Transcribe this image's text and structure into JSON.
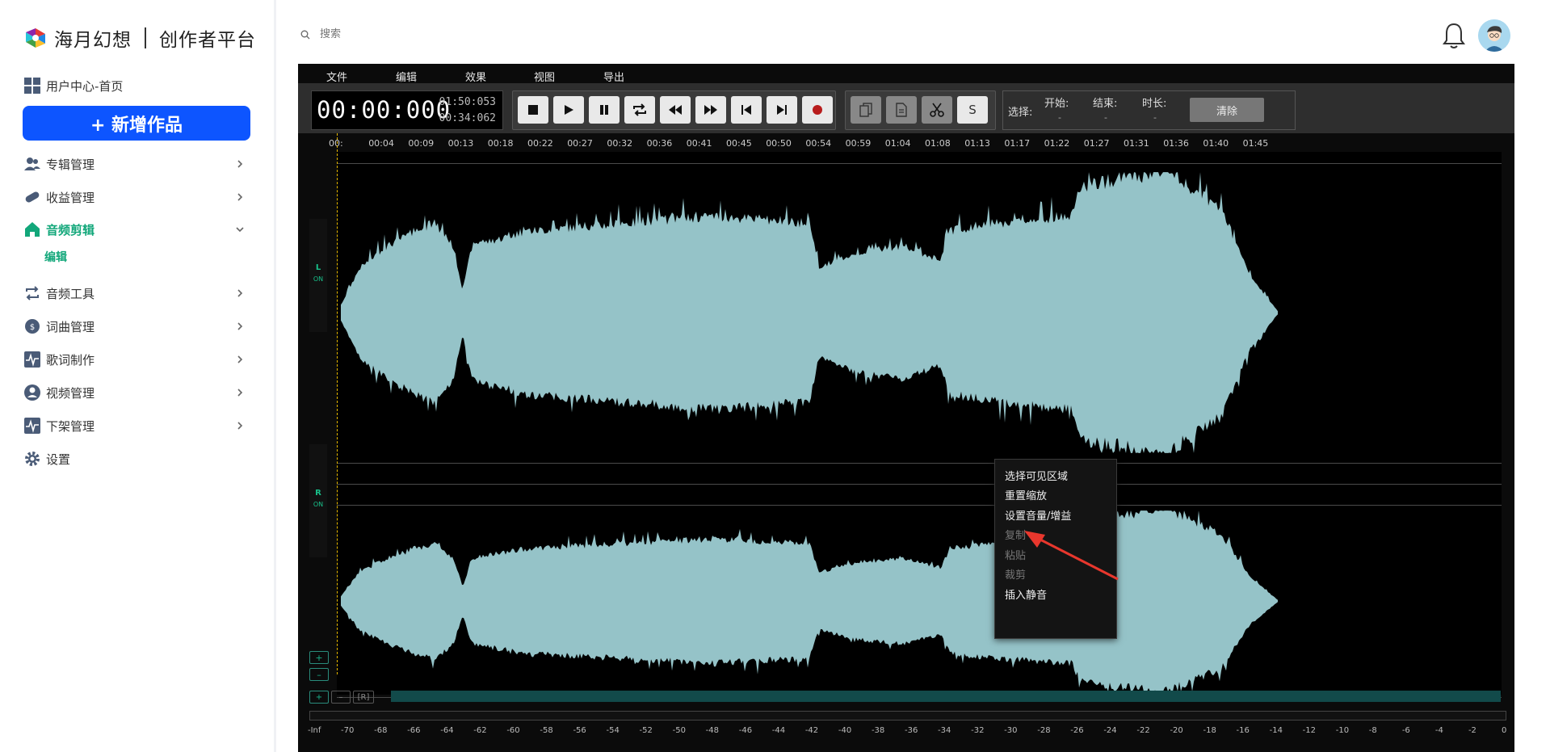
{
  "brand": {
    "name": "海月幻想",
    "platform": "创作者平台"
  },
  "sidebar": {
    "home_label": "用户中心-首页",
    "new_button": "+ 新增作品",
    "items": [
      {
        "label": "专辑管理",
        "icon": "users-icon"
      },
      {
        "label": "收益管理",
        "icon": "pill-icon"
      },
      {
        "label": "音频剪辑",
        "icon": "home-icon",
        "active": true
      },
      {
        "label": "音频工具",
        "icon": "repeat-icon"
      },
      {
        "label": "词曲管理",
        "icon": "coin-icon"
      },
      {
        "label": "歌词制作",
        "icon": "pulse-icon"
      },
      {
        "label": "视频管理",
        "icon": "user-circle-icon"
      },
      {
        "label": "下架管理",
        "icon": "pulse-icon"
      },
      {
        "label": "设置",
        "icon": "gear-icon"
      }
    ],
    "sub_item": "编辑"
  },
  "search": {
    "placeholder": "搜索"
  },
  "editor": {
    "menu": [
      "文件",
      "编辑",
      "效果",
      "视图",
      "导出"
    ],
    "time": {
      "current": "00:00:000",
      "end": "01:50:053",
      "total": "00:34:062"
    },
    "selection": {
      "label": "选择:",
      "start_label": "开始:",
      "end_label": "结束:",
      "length_label": "时长:",
      "start_value": "-",
      "end_value": "-",
      "length_value": "-",
      "clear_label": "清除"
    },
    "s_button": "S",
    "ruler": [
      "00:",
      "00:04",
      "00:09",
      "00:13",
      "00:18",
      "00:22",
      "00:27",
      "00:32",
      "00:36",
      "00:41",
      "00:45",
      "00:50",
      "00:54",
      "00:59",
      "01:04",
      "01:08",
      "01:13",
      "01:17",
      "01:22",
      "01:27",
      "01:31",
      "01:36",
      "01:40",
      "01:45"
    ],
    "channels": [
      {
        "name": "L",
        "state": "ON"
      },
      {
        "name": "R",
        "state": "ON"
      }
    ],
    "zoom_in": "+",
    "zoom_out": "–",
    "reset": "[R]",
    "meter": [
      "-Inf",
      "-70",
      "-68",
      "-66",
      "-64",
      "-62",
      "-60",
      "-58",
      "-56",
      "-54",
      "-52",
      "-50",
      "-48",
      "-46",
      "-44",
      "-42",
      "-40",
      "-38",
      "-36",
      "-34",
      "-32",
      "-30",
      "-28",
      "-26",
      "-24",
      "-22",
      "-20",
      "-18",
      "-16",
      "-14",
      "-12",
      "-10",
      "-8",
      "-6",
      "-4",
      "-2",
      "0"
    ],
    "wave_color": "#95c3c8",
    "accent": "#18c08a"
  },
  "context_menu": [
    {
      "label": "选择可见区域",
      "enabled": true
    },
    {
      "label": "重置缩放",
      "enabled": true
    },
    {
      "label": "设置音量/增益",
      "enabled": true
    },
    {
      "label": "复制",
      "enabled": false
    },
    {
      "label": "粘贴",
      "enabled": false
    },
    {
      "label": "裁剪",
      "enabled": false
    },
    {
      "label": "插入静音",
      "enabled": true
    }
  ],
  "colors": {
    "primary": "#0d55ff",
    "active": "#12a77a",
    "annotation": "#e8372d"
  }
}
